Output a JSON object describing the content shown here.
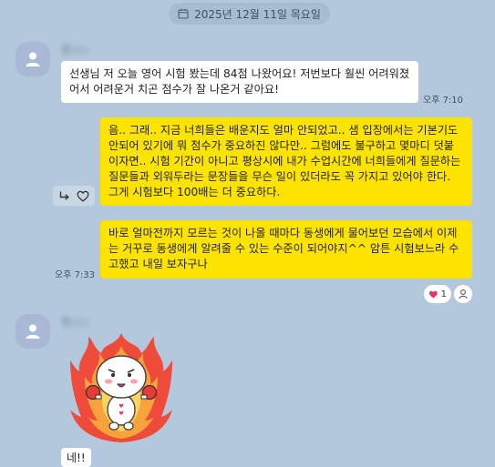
{
  "date_divider": {
    "label": "2025년 12월 11일 목요일"
  },
  "messages": [
    {
      "sender_name": "정○○",
      "text": "선생님 저 오늘 영어 시험 봤는데 84점 나왔어요! 저번보다 훨씬 어려워졌어서 어려운거 치곤 점수가 잘 나온거 같아요!",
      "time": "오후 7:10"
    },
    {
      "text": "음.. 그래.. 지금 너희들은 배운지도 얼마 안되었고.. 샘 입장에서는 기본기도 안되어 있기에 뭐 점수가 중요하진 않다만.. 그럼에도 불구하고 몇마디 덧붙이자면.. 시험 기간이 아니고 평상시에 내가 수업시간에 너희들에게 질문하는 질문들과 외워두라는 문장들을 무슨 일이 있더라도 꼭 가지고 있어야 한다. 그게 시험보다 100배는 더 중요하다."
    },
    {
      "text": "바로 얼마전까지 모르는 것이 나올 때마다 동생에게 물어보던 모습에서 이제는 거꾸로 동생에게 알려줄 수 있는 수준이 되어야지^^ 암튼 시험보느라 수고했고 내일 보자구나",
      "time": "오후 7:33",
      "like_count": "1"
    },
    {
      "sender_name": "정○○",
      "sticker": "fire-cheer-sticker",
      "partial_text": "네!!"
    }
  ],
  "icons": {
    "calendar": "calendar-icon",
    "avatar": "person-icon",
    "reply": "reply-arrow-icon",
    "like": "heart-icon",
    "profile": "person-outline-icon"
  },
  "colors": {
    "background": "#b3c8dd",
    "my_bubble": "#fde400",
    "their_bubble": "#ffffff",
    "heart": "#e8336d"
  }
}
